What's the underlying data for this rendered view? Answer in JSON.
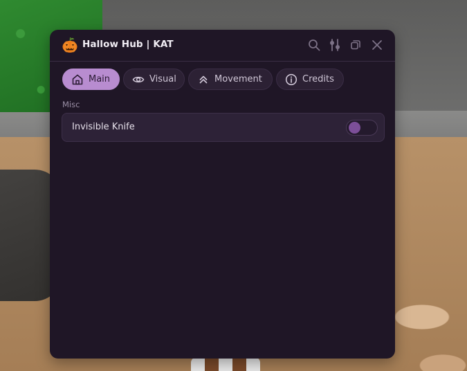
{
  "window": {
    "title": "Hallow Hub | KAT",
    "logo_icon": "pumpkin-icon",
    "controls": [
      "search-icon",
      "sliders-icon",
      "restore-icon",
      "close-icon"
    ]
  },
  "tabs": [
    {
      "label": "Main",
      "icon": "home-icon",
      "active": true
    },
    {
      "label": "Visual",
      "icon": "eye-icon",
      "active": false
    },
    {
      "label": "Movement",
      "icon": "double-chevron-up-icon",
      "active": false
    },
    {
      "label": "Credits",
      "icon": "info-icon",
      "active": false
    }
  ],
  "section": {
    "label": "Misc"
  },
  "toggles": [
    {
      "label": "Invisible Knife",
      "state": "off"
    }
  ],
  "colors": {
    "window_bg": "#1f1626",
    "accent": "#b88cd0",
    "toggle_knob": "#7c4f98"
  }
}
